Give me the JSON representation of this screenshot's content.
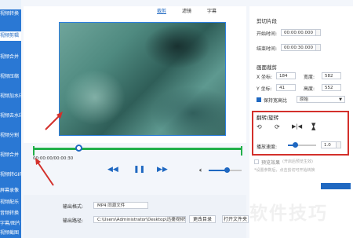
{
  "sidebar": {
    "items": [
      {
        "label": "视频转换",
        "active": false
      },
      {
        "label": "视频剪辑",
        "active": true
      },
      {
        "label": "视频合并",
        "active": false
      },
      {
        "label": "视频压缩",
        "active": false
      },
      {
        "label": "视频加水印",
        "active": false
      },
      {
        "label": "视频去水印",
        "active": false
      },
      {
        "label": "视频分割",
        "active": false
      },
      {
        "label": "视频合并",
        "active": false
      },
      {
        "label": "视频转GIF",
        "active": false
      },
      {
        "label": "屏幕录像",
        "active": false
      },
      {
        "label": "视频配乐",
        "active": false
      },
      {
        "label": "音频转换",
        "active": false
      },
      {
        "label": "字幕/图片",
        "active": false
      },
      {
        "label": "视频截图",
        "active": false
      }
    ]
  },
  "preview": {
    "tabs": [
      {
        "label": "裁剪",
        "active": true
      },
      {
        "label": "滤镜",
        "active": false
      },
      {
        "label": "字幕",
        "active": false
      }
    ],
    "time_text": "00:00:00/00:00:30",
    "progress": 0.22
  },
  "volume": {
    "level": 0.55
  },
  "output": {
    "format_label": "输出格式:",
    "format_value": "MP4  同源文件",
    "path_label": "输出路径:",
    "path_value": "C:\\Users\\Administrator\\Desktop\\迅捷视频转换器",
    "change_dir_button": "更改目录",
    "open_folder_button": "打开文件夹"
  },
  "right_panel": {
    "clip_title": "剪切片段",
    "start_label": "开始时间:",
    "start_value": "00:00:00.000",
    "end_label": "结束时间:",
    "end_value": "00:00:30.000",
    "crop_title": "画面裁剪",
    "x_label": "X 坐标:",
    "x_value": "184",
    "width_label": "宽度:",
    "width_value": "582",
    "y_label": "Y 坐标:",
    "y_value": "41",
    "height_label": "高度:",
    "height_value": "552",
    "keep_ratio_label": "保持宽高比",
    "ratio_value": "原始",
    "rotate_title": "翻转/旋转",
    "speed_label": "播放速度:",
    "speed_value": "1.0",
    "speed_level": 0.25,
    "preview_effect_label": "预览效果",
    "preview_effect_note": "(开启后预览生效)",
    "note_text": "*设置参数后，点击剪切可开始转换"
  },
  "watermark": "软件技巧",
  "colors": {
    "accent": "#1f68c1",
    "timeline_green": "#22b04a",
    "highlight_red": "#d3302b",
    "sidebar_bg": "#2a78d4"
  }
}
